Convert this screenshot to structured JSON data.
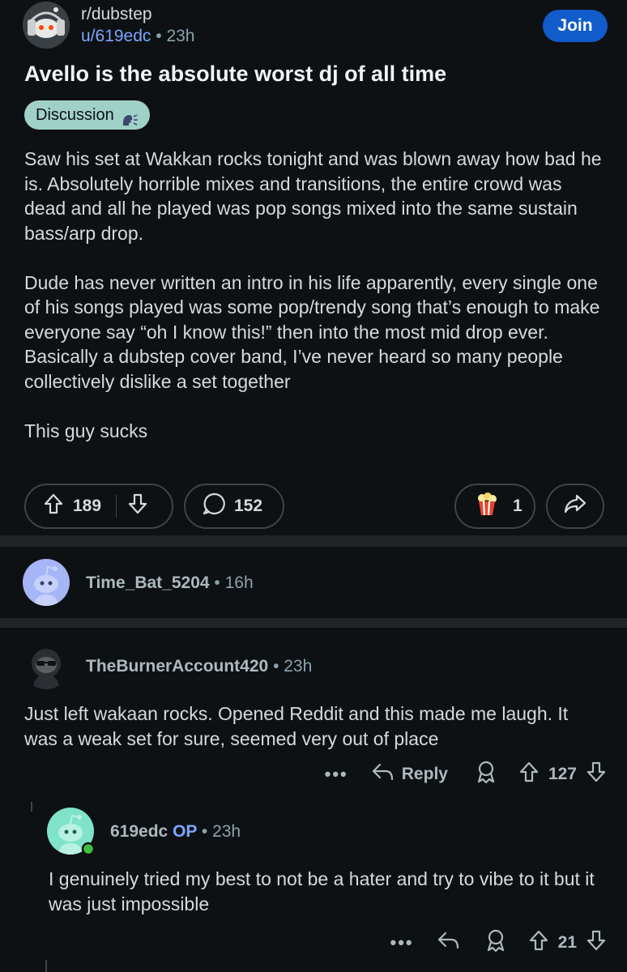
{
  "post": {
    "subreddit": "r/dubstep",
    "author": "u/619edc",
    "time": "23h",
    "join_label": "Join",
    "title": "Avello is the absolute worst dj of all time",
    "flair": "Discussion",
    "body": [
      "Saw his set at Wakkan rocks tonight and was blown away how bad he is. Absolutely horrible mixes and transitions, the entire crowd was dead and all he played was pop songs mixed into the same sustain bass/arp drop.",
      "Dude has never written an intro in his life apparently, every single one of his songs played was some pop/trendy song that’s enough to make everyone say “oh I know this!” then into the most mid drop ever. Basically a dubstep cover band, I’ve never heard so many people collectively dislike a set together",
      "This guy sucks"
    ],
    "upvotes": "189",
    "comments": "152",
    "awards": "1"
  },
  "comments": [
    {
      "user": "Time_Bat_5204",
      "time": "16h",
      "avatar_color": "#a6b5f5"
    },
    {
      "user": "TheBurnerAccount420",
      "time": "23h",
      "text": "Just left wakaan rocks. Opened Reddit and this made me laugh. It was a weak set for sure, seemed very out of place",
      "reply_label": "Reply",
      "votes": "127",
      "reply": {
        "user": "619edc",
        "op_label": "OP",
        "time": "23h",
        "text": "I genuinely tried my best to not be a hater and try to vibe to it but it was just impossible",
        "votes": "21",
        "avatar_color": "#7ee3c9"
      }
    }
  ],
  "colors": {
    "background": "#0e1113",
    "accent": "#115bca",
    "flair_bg": "#a0d1c8",
    "link": "#7aa6ff"
  }
}
